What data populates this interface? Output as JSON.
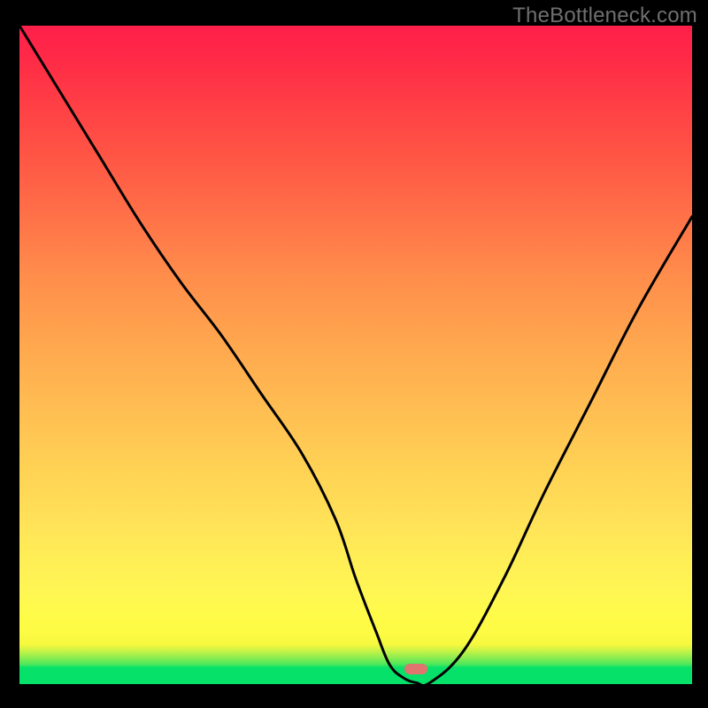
{
  "watermark": "TheBottleneck.com",
  "chart_data": {
    "type": "line",
    "title": "",
    "xlabel": "",
    "ylabel": "",
    "xlim": [
      0,
      100
    ],
    "ylim": [
      0,
      100
    ],
    "grid": false,
    "legend": false,
    "series": [
      {
        "name": "bottleneck-curve",
        "x": [
          0,
          6,
          12,
          18,
          24,
          30,
          36,
          42,
          47,
          50,
          53,
          55,
          57,
          59,
          61,
          66,
          72,
          78,
          85,
          92,
          100
        ],
        "values": [
          100,
          90,
          80,
          70,
          61,
          53,
          44,
          35,
          25,
          16,
          8,
          3,
          1,
          0.2,
          0.2,
          5,
          16,
          29,
          43,
          57,
          71
        ]
      }
    ],
    "marker": {
      "x": 59,
      "y_bottom_pct": 2.3
    },
    "gradient_stops": [
      {
        "pct": 0,
        "color": "#06e169"
      },
      {
        "pct": 6,
        "color": "#f6f83f"
      },
      {
        "pct": 25,
        "color": "#ffe158"
      },
      {
        "pct": 52,
        "color": "#ffa64e"
      },
      {
        "pct": 80,
        "color": "#ff5645"
      },
      {
        "pct": 100,
        "color": "#ff1f4a"
      }
    ]
  }
}
